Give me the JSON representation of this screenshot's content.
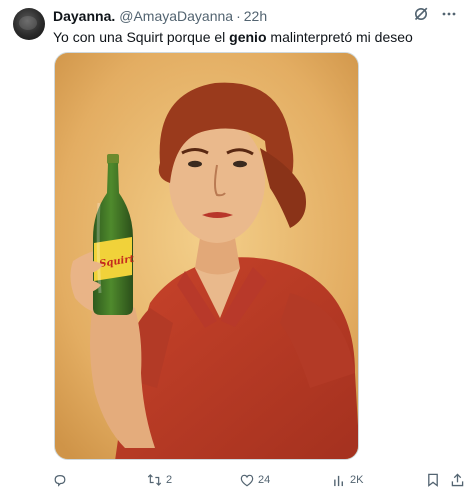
{
  "author": {
    "name": "Dayanna.",
    "handle": "@AmayaDayanna",
    "separator": "·",
    "time": "22h"
  },
  "tweet": {
    "text_before": "Yo con una Squirt porque el ",
    "text_bold": "genio",
    "text_after": " malinterpretó mi deseo"
  },
  "media": {
    "bottle_label": "Squirt"
  },
  "actions": {
    "reply_count": "",
    "retweet_count": "2",
    "like_count": "24",
    "views_count": "2K"
  },
  "icons": {
    "grok": "grok-icon",
    "more": "more-icon",
    "reply": "reply-icon",
    "retweet": "retweet-icon",
    "like": "heart-icon",
    "views": "views-icon",
    "bookmark": "bookmark-icon",
    "share": "share-icon"
  },
  "colors": {
    "text": "#0f1419",
    "secondary": "#536471",
    "border": "#cfd9de"
  }
}
